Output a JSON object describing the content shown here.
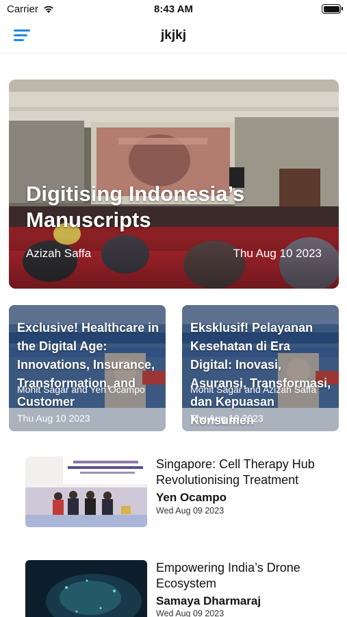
{
  "status_bar": {
    "carrier": "Carrier",
    "time": "8:43 AM"
  },
  "nav": {
    "title": "jkjkj"
  },
  "hero": {
    "title": "Digitising Indonesia’s Manuscripts",
    "author": "Azizah Saffa",
    "date": "Thu Aug 10 2023"
  },
  "cards": [
    {
      "title": "Exclusive! Healthcare in the Digital Age: Innovations, Insurance, Transformation, and Customer",
      "author": "Mohit Sagar and Yen Ocampo",
      "date": "Thu Aug 10 2023"
    },
    {
      "title": "Eksklusif! Pelayanan Kesehatan di Era Digital: Inovasi, Asuransi, Transformasi, dan Kepuasan Konsumen",
      "author": "Mohit Sagar and Azizah Saffa",
      "date": "Thu Aug 10 2023"
    }
  ],
  "articles": [
    {
      "title": "Singapore: Cell Therapy Hub Revolutionising Treatment",
      "author": "Yen Ocampo",
      "date": "Wed Aug 09 2023"
    },
    {
      "title": "Empowering India’s Drone Ecosystem",
      "author": "Samaya Dharmaraj",
      "date": "Wed Aug 09 2023"
    }
  ],
  "colors": {
    "accent": "#1e88e5",
    "text": "#111111"
  }
}
